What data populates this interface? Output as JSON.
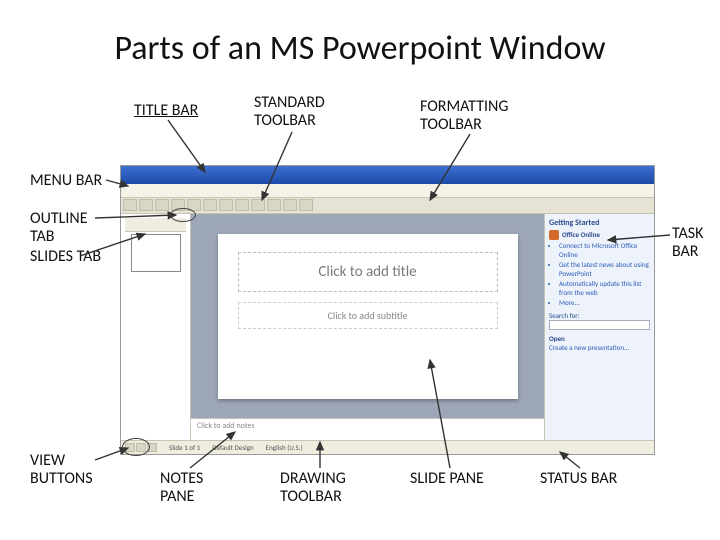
{
  "title": "Parts of an MS Powerpoint Window",
  "labels": {
    "titleBar": "TITLE BAR",
    "standardToolbar": "STANDARD TOOLBAR",
    "formattingToolbar": "FORMATTING TOOLBAR",
    "menuBar": "MENU BAR",
    "outlineTab": "OUTLINE TAB",
    "slidesTab": "SLIDES TAB",
    "taskBar": "TASK BAR",
    "viewButtons": "VIEW BUTTONS",
    "notesPane": "NOTES PANE",
    "drawingToolbar": "DRAWING TOOLBAR",
    "slidePane": "SLIDE PANE",
    "statusBar": "STATUS BAR"
  },
  "ppt": {
    "titlePlaceholder": "Click to add title",
    "subtitlePlaceholder": "Click to add subtitle",
    "notesPlaceholder": "Click to add notes",
    "taskPane": {
      "header": "Getting Started",
      "brand": "Office Online",
      "items": [
        "Connect to Microsoft Office Online",
        "Get the latest news about using PowerPoint",
        "Automatically update this list from the web",
        "More..."
      ],
      "search": "Search for:",
      "open": "Open",
      "create": "Create a new presentation..."
    },
    "status": {
      "slide": "Slide 1 of 1",
      "layout": "Default Design",
      "lang": "English (U.S.)"
    }
  }
}
